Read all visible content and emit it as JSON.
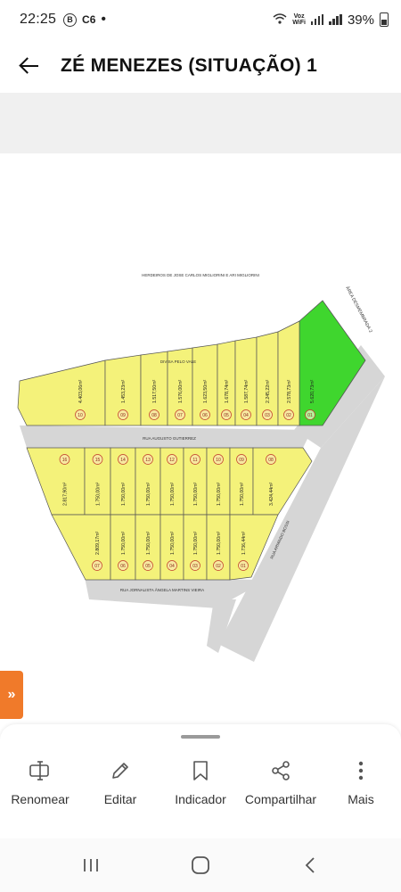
{
  "status": {
    "time": "22:25",
    "app_badges": [
      "B",
      "C6"
    ],
    "signal_label_top": "Voz",
    "signal_label_bottom": "WiFi",
    "battery": "39%"
  },
  "header": {
    "title": "ZÉ MENEZES (SITUAÇÃO) 1"
  },
  "map": {
    "top_label": "HERDEIROS DE JOSE CARLOS MIGLIORINI E ARI MIGLIORINI",
    "area_label": "ÁREA DESMEMBRADA 2",
    "divisa_label": "DIVISA PELO VALE",
    "street_1": "RUA AUGUSTO GUTIERREZ",
    "street_2": "RUA JORNALISTA ÂNGELA MARTINS VIEIRA",
    "street_3": "RUA ARMINDO BOSSI",
    "row1_lots": [
      {
        "num": "10",
        "area": "4.403,06m²"
      },
      {
        "num": "09",
        "area": "1.453,23m²"
      },
      {
        "num": "08",
        "area": "1.517,50m²"
      },
      {
        "num": "07",
        "area": "1.576,00m²"
      },
      {
        "num": "06",
        "area": "1.623,50m²"
      },
      {
        "num": "05",
        "area": "1.678,74m²"
      },
      {
        "num": "04",
        "area": "1.587,74m²"
      },
      {
        "num": "03",
        "area": "2.245,22m²"
      },
      {
        "num": "02",
        "area": "2.578,73m²"
      },
      {
        "num": "01",
        "area": "5.620,73m²"
      }
    ],
    "row2_lots": [
      {
        "num": "16",
        "area": "2.817,90m²"
      },
      {
        "num": "15",
        "area": "1.750,00m²"
      },
      {
        "num": "14",
        "area": "1.750,00m²"
      },
      {
        "num": "13",
        "area": "1.750,00m²"
      },
      {
        "num": "12",
        "area": "1.750,00m²"
      },
      {
        "num": "11",
        "area": "1.750,00m²"
      },
      {
        "num": "10",
        "area": "1.750,00m²"
      },
      {
        "num": "09",
        "area": "1.750,00m²"
      },
      {
        "num": "08",
        "area": "3.424,44m²"
      }
    ],
    "row3_lots": [
      {
        "num": "07",
        "area": "2.809,17m²"
      },
      {
        "num": "06",
        "area": "1.750,00m²"
      },
      {
        "num": "05",
        "area": "1.750,00m²"
      },
      {
        "num": "04",
        "area": "1.750,00m²"
      },
      {
        "num": "03",
        "area": "1.750,00m²"
      },
      {
        "num": "02",
        "area": "1.750,00m²"
      },
      {
        "num": "01",
        "area": "1.736,44m²"
      }
    ],
    "colors": {
      "lot_fill": "#f4f27a",
      "green_fill": "#3fd62e",
      "road_fill": "#d6d6d6",
      "lot_stroke": "#555555",
      "circle_stroke": "#c0392b"
    }
  },
  "sidetab": {
    "icon": "double-chevron-right-icon",
    "glyph": "»"
  },
  "actions": [
    {
      "label": "Renomear",
      "icon": "rename-icon"
    },
    {
      "label": "Editar",
      "icon": "pencil-icon"
    },
    {
      "label": "Indicador",
      "icon": "bookmark-icon"
    },
    {
      "label": "Compartilhar",
      "icon": "share-icon"
    },
    {
      "label": "Mais",
      "icon": "more-vertical-icon"
    }
  ],
  "navbar": [
    {
      "icon": "recent-apps-icon"
    },
    {
      "icon": "home-icon"
    },
    {
      "icon": "back-icon"
    }
  ]
}
